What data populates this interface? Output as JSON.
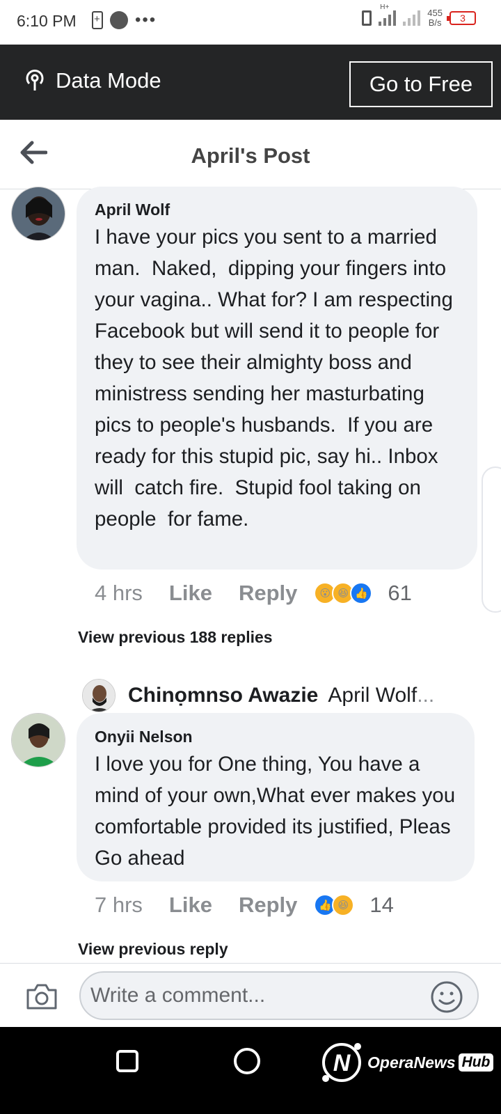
{
  "status_bar": {
    "time": "6:10 PM",
    "net_speed_value": "455",
    "net_speed_unit": "B/s",
    "network_type": "H+",
    "battery_level": "3"
  },
  "data_mode": {
    "label": "Data Mode",
    "go_free_label": "Go to Free"
  },
  "header": {
    "title": "April's Post"
  },
  "comments": [
    {
      "author": "April Wolf",
      "text": "I have your pics you sent to a married man.  Naked,  dipping your fingers into your vagina.. What for? I am respecting Facebook but will send it to people for  they to see their almighty boss and ministress sending her masturbating pics to people's husbands.  If you are ready for this stupid pic, say hi.. Inbox will  catch fire.  Stupid fool taking on people  for fame.",
      "time": "4 hrs",
      "like_label": "Like",
      "reply_label": "Reply",
      "reaction_count": "61",
      "reactions": [
        "wow",
        "haha",
        "like"
      ],
      "view_previous": "View previous 188 replies",
      "latest_reply": {
        "author": "Chinọmnso Awazie",
        "preview": "April Wolf",
        "ellipsis": "..."
      }
    },
    {
      "author": "Onyii Nelson",
      "text": "I love you for One thing, You have a mind of your own,What ever makes you comfortable provided its justified, Pleas Go ahead",
      "time": "7 hrs",
      "like_label": "Like",
      "reply_label": "Reply",
      "reaction_count": "14",
      "reactions": [
        "like",
        "haha"
      ],
      "view_previous": "View previous reply"
    }
  ],
  "composer": {
    "placeholder": "Write a comment..."
  },
  "watermark": {
    "text": "OperaNews",
    "badge": "Hub"
  },
  "colors": {
    "data_bar_bg": "#242526",
    "bubble_bg": "#f0f2f5",
    "like_blue": "#1877f2",
    "reaction_yellow": "#f7b125",
    "battery_red": "#d9231d"
  }
}
